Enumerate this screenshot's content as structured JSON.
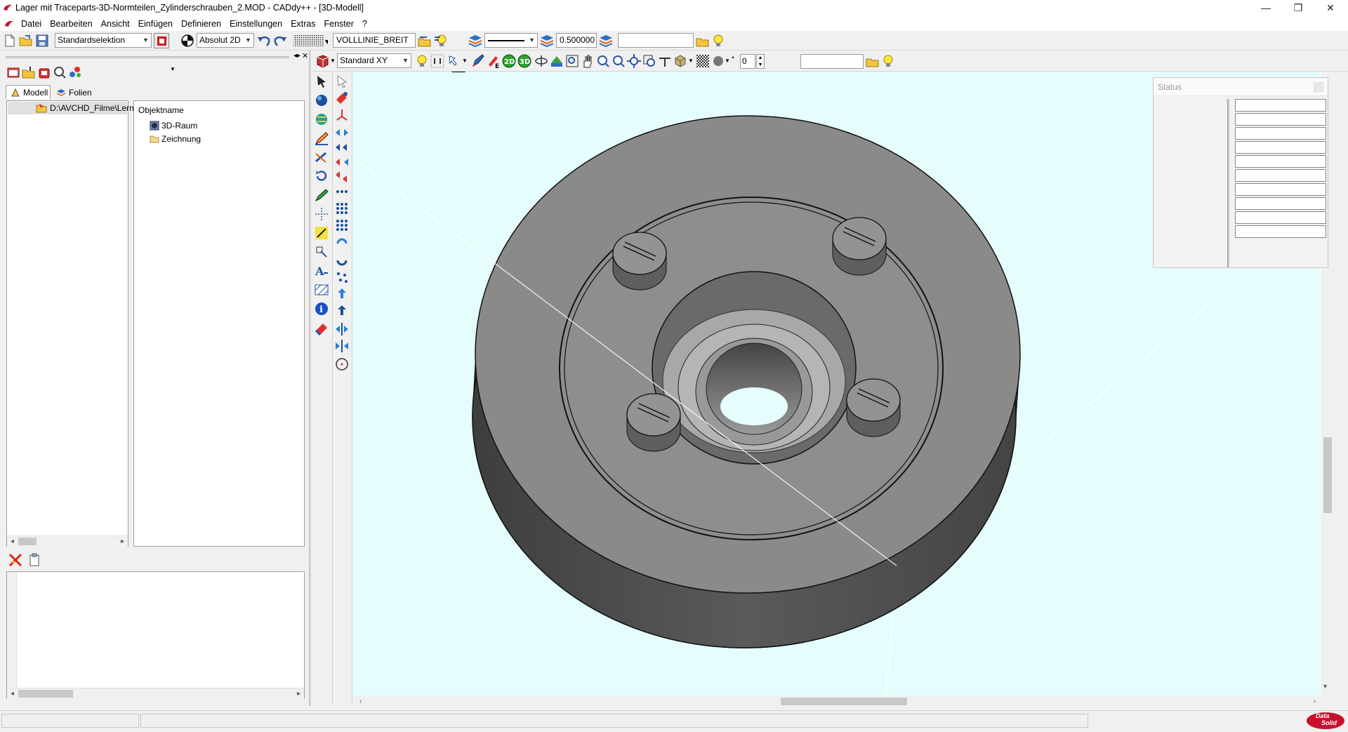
{
  "window": {
    "title": "Lager mit Traceparts-3D-Normteilen_Zylinderschrauben_2.MOD  -  CADdy++ - [3D-Modell]",
    "minimize_glyph": "—",
    "restore_glyph": "❐",
    "close_glyph": "✕"
  },
  "menu": [
    "Datei",
    "Bearbeiten",
    "Ansicht",
    "Einfügen",
    "Definieren",
    "Einstellungen",
    "Extras",
    "Fenster",
    "?"
  ],
  "toolbar1": {
    "selection_mode": "Standardselektion",
    "coord_mode": "Absolut 2D",
    "line_type": "VOLLLINIE_BREIT",
    "line_width": "0.500000",
    "text_field": ""
  },
  "toolbar2": {
    "view_plane": "Standard XY",
    "step_value": "0",
    "text_field": ""
  },
  "left_panel": {
    "tabs": [
      "Modell",
      "Folien"
    ],
    "path": "D:\\AVCHD_Filme\\Lern",
    "column_header": "Objektname",
    "objects": [
      "3D-Raum",
      "Zeichnung"
    ]
  },
  "status_panel": {
    "title": "Status"
  },
  "brand": {
    "logo_text_1": "Data",
    "logo_text_2": "Solid",
    "color": "#c8102e"
  },
  "colors": {
    "viewport_bg": "#e6fdfd",
    "accent_red": "#c8102e"
  }
}
